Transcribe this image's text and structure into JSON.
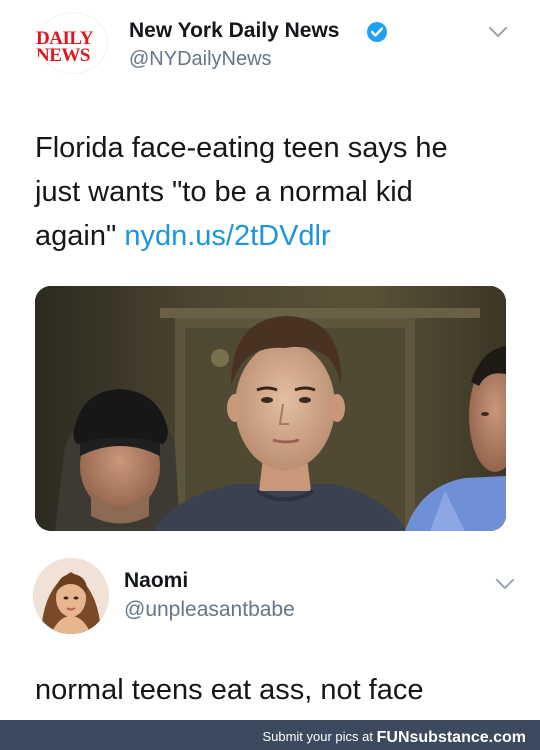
{
  "tweet": {
    "logo_lines": [
      "DAILY",
      "NEWS"
    ],
    "display_name": "New York Daily News",
    "handle": "@NYDailyNews",
    "verified_icon": "verified-badge-icon",
    "text_line1": "Florida face-eating teen says he",
    "text_line2": "just wants \"to be a normal kid",
    "text_line3": "again\"",
    "link": "nydn.us/2tDVdlr",
    "link_color": "#1b95e0",
    "menu_icon": "chevron-down-icon"
  },
  "reply": {
    "display_name": "Naomi",
    "handle": "@unpleasantbabe",
    "text": "normal teens eat ass, not face",
    "menu_icon": "chevron-down-icon"
  },
  "footer": {
    "text": "Submit your pics at",
    "brand": "FUNsubstance.com",
    "color": "#3b4a5e"
  }
}
